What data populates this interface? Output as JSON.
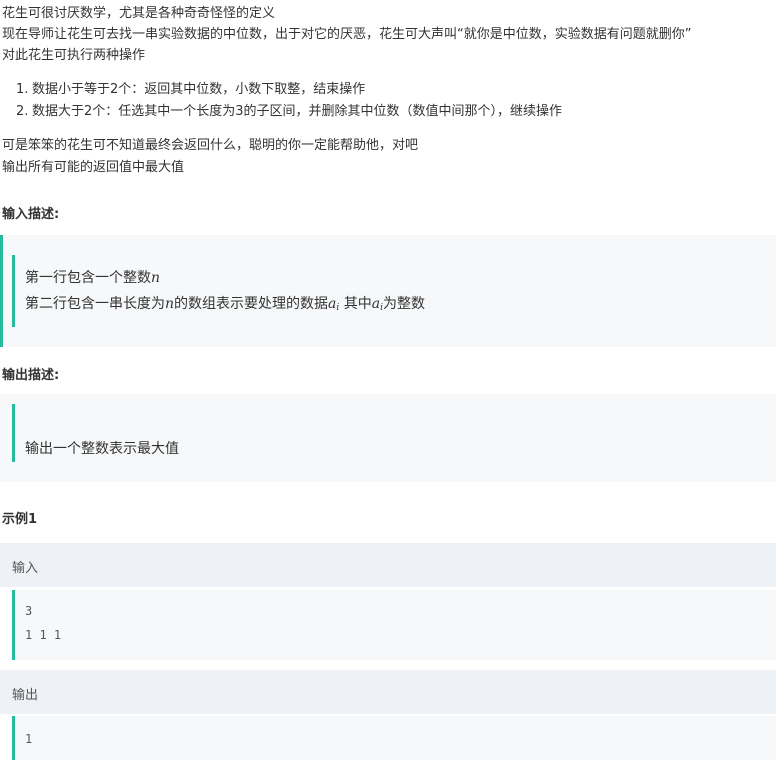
{
  "intro": {
    "line1": "花生可很讨厌数学，尤其是各种奇奇怪怪的定义",
    "line2": "现在导师让花生可去找一串实验数据的中位数，出于对它的厌恶，花生可大声叫“就你是中位数，实验数据有问题就删你”",
    "line3": "对此花生可执行两种操作"
  },
  "operations": [
    {
      "num": "1.",
      "text": "数据小于等于2个：返回其中位数，小数下取整，结束操作"
    },
    {
      "num": "2.",
      "text": "数据大于2个：任选其中一个长度为3的子区间，并删除其中位数（数值中间那个），继续操作"
    }
  ],
  "closing": {
    "line1": "可是笨笨的花生可不知道最终会返回什么，聪明的你一定能帮助他，对吧",
    "line2": "输出所有可能的返回值中最大值"
  },
  "input_desc": {
    "title": "输入描述:",
    "line1_text": "第一行包含一个整数",
    "line1_var": "n",
    "line2_a": "第二行包含一串长度为",
    "line2_var": "n",
    "line2_b": "的数组表示要处理的数据",
    "line2_ai": "a",
    "line2_sub": "i",
    "line2_c": " 其中",
    "line2_ai2": "a",
    "line2_sub2": "i",
    "line2_d": "为整数"
  },
  "output_desc": {
    "title": "输出描述:",
    "line1": "输出一个整数表示最大值"
  },
  "example": {
    "title": "示例1",
    "input_label": "输入",
    "input_lines": [
      "3",
      "1 1 1"
    ],
    "output_label": "输出",
    "output_lines": [
      "1"
    ]
  },
  "colors": {
    "accent": "#25bb9b",
    "panel": "#f7f8fa",
    "header": "#eef1f6"
  }
}
